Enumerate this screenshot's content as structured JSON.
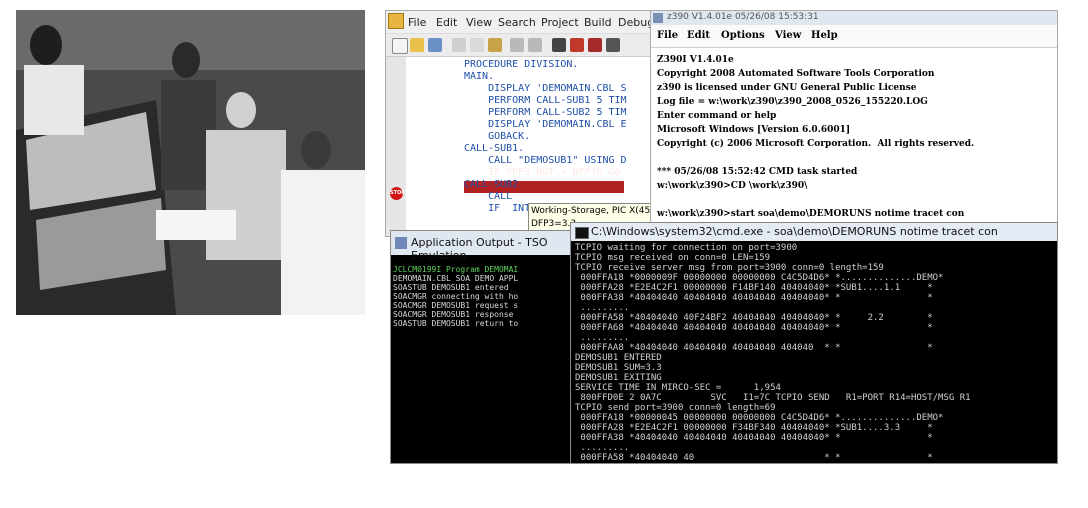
{
  "ide": {
    "menu": [
      "File",
      "Edit",
      "View",
      "Search",
      "Project",
      "Build",
      "Debug"
    ],
    "code_lines": [
      "PROCEDURE DIVISION.",
      "MAIN.",
      "    DISPLAY 'DEMOMAIN.CBL S",
      "    PERFORM CALL-SUB1 5 TIM",
      "    PERFORM CALL-SUB2 5 TIM",
      "    DISPLAY 'DEMOMAIN.CBL E",
      "    GOBACK.",
      "CALL-SUB1.",
      "    CALL \"DEMOSUB1\" USING D",
      "    IF DFP3 NOT = DFP3V GO",
      "CALL-SUB2",
      "    CALL",
      "    IF  INT3 NOT"
    ],
    "tooltip": [
      "Working-Storage, PIC X(45)",
      "DFP3=3.3"
    ],
    "stop_label": "STOP"
  },
  "z390": {
    "title": "z390 V1.4.01e  05/26/08 15:53:31",
    "menu": [
      "File",
      "Edit",
      "Options",
      "View",
      "Help"
    ],
    "lines": [
      "Z390I V1.4.01e",
      "Copyright 2008 Automated Software Tools Corporation",
      "z390 is licensed under GNU General Public License",
      "Log file = w:\\work\\z390\\z390_2008_0526_155220.LOG",
      "Enter command or help",
      "Microsoft Windows [Version 6.0.6001]",
      "Copyright (c) 2006 Microsoft Corporation.  All rights reserved.",
      "",
      "*** 05/26/08 15:52:42 CMD task started",
      "w:\\work\\z390>CD \\work\\z390\\",
      "",
      "w:\\work\\z390>start soa\\demo\\DEMORUNS notime tracet con"
    ]
  },
  "appout": {
    "title": "Application Output - TSO Emulation",
    "lines": [
      "JCLCM0199I Program DEMOMAI",
      "DEMOMAIN.CBL SOA DEMO APPL",
      "SOASTUB DEMOSUB1 entered",
      "SOACMGR connecting with ho",
      "SOACMGR DEMOSUB1 request s",
      "SOACMGR DEMOSUB1 response",
      "SOASTUB DEMOSUB1 return to"
    ]
  },
  "cmd": {
    "title": "C:\\Windows\\system32\\cmd.exe - soa\\demo\\DEMORUNS  notime tracet con",
    "lines": [
      "TCPIO waiting for connection on port=3900",
      "TCPIO msg received on conn=0 LEN=159",
      "TCPIO receive server msg from port=3900 conn=0 length=159",
      " 000FFA18 *0000009F 00000000 00000000 C4C5D4D6* *..............DEMO*",
      " 000FFA28 *E2E4C2F1 00000000 F14BF140 40404040* *SUB1....1.1     *",
      " 000FFA38 *40404040 40404040 40404040 40404040* *                *",
      " .........",
      " 000FFA58 *40404040 40F24BF2 40404040 40404040* *     2.2        *",
      " 000FFA68 *40404040 40404040 40404040 40404040* *                *",
      " .........",
      " 000FFAA8 *40404040 40404040 40404040 404040  * *                *",
      "DEMOSUB1 ENTERED",
      "DEMOSUB1 SUM=3.3",
      "DEMOSUB1 EXITING",
      "SERVICE TIME IN MIRCO-SEC =      1,954",
      " 800FFD0E 2 0A7C         SVC   I1=7C TCPIO SEND   R1=PORT R14=HOST/MSG R1",
      "TCPIO send port=3900 conn=0 length=69",
      " 000FFA18 *00000045 00000000 00000000 C4C5D4D6* *..............DEMO*",
      " 000FFA28 *E2E4C2F1 00000000 F34BF340 40404040* *SUB1....3.3     *",
      " 000FFA38 *40404040 40404040 40404040 40404040* *                *",
      " .........",
      " 000FFA58 *40404040 40                        * *                *"
    ]
  }
}
